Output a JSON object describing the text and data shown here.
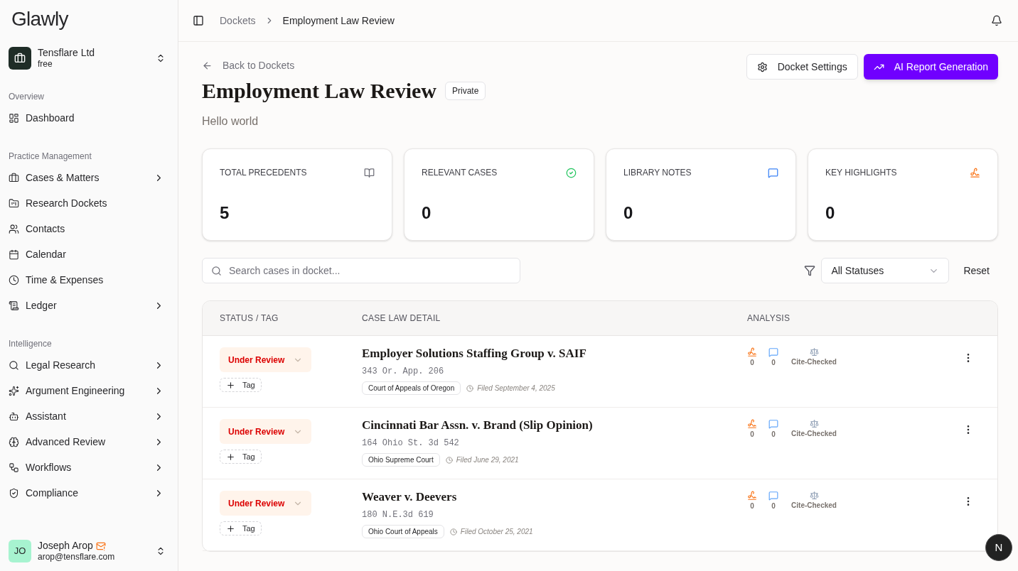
{
  "sidebar": {
    "logo": "Glawly",
    "org": {
      "name": "Tensflare Ltd",
      "plan": "free"
    },
    "sections": [
      {
        "title": "Overview",
        "items": [
          {
            "label": "Dashboard",
            "has_children": false
          }
        ]
      },
      {
        "title": "Practice Management",
        "items": [
          {
            "label": "Cases & Matters",
            "has_children": true
          },
          {
            "label": "Research Dockets",
            "has_children": false
          },
          {
            "label": "Contacts",
            "has_children": false
          },
          {
            "label": "Calendar",
            "has_children": false
          },
          {
            "label": "Time & Expenses",
            "has_children": false
          },
          {
            "label": "Ledger",
            "has_children": true
          }
        ]
      },
      {
        "title": "Intelligence",
        "items": [
          {
            "label": "Legal Research",
            "has_children": true
          },
          {
            "label": "Argument Engineering",
            "has_children": true
          },
          {
            "label": "Assistant",
            "has_children": true
          },
          {
            "label": "Advanced Review",
            "has_children": true
          },
          {
            "label": "Workflows",
            "has_children": true
          },
          {
            "label": "Compliance",
            "has_children": true
          }
        ]
      }
    ],
    "user": {
      "initials": "JO",
      "name": "Joseph Arop",
      "email": "arop@tensflare.com"
    }
  },
  "breadcrumb": [
    "Dockets",
    "Employment Law Review"
  ],
  "back_link": "Back to Dockets",
  "actions": [
    {
      "label": "Docket Settings",
      "kind": "secondary"
    },
    {
      "label": "AI Report Generation",
      "kind": "primary"
    }
  ],
  "title": "Employment Law Review",
  "visibility": "Private",
  "description": "Hello world",
  "stats": [
    {
      "label": "TOTAL PRECEDENTS",
      "value": "5"
    },
    {
      "label": "RELEVANT CASES",
      "value": "0"
    },
    {
      "label": "LIBRARY NOTES",
      "value": "0"
    },
    {
      "label": "KEY HIGHLIGHTS",
      "value": "0"
    }
  ],
  "search": {
    "placeholder": "Search cases in docket..."
  },
  "status_filter": "All Statuses",
  "reset": "Reset",
  "table": {
    "columns": [
      "STATUS / TAG",
      "CASE LAW DETAIL",
      "ANALYSIS"
    ],
    "rows": [
      {
        "status": "Under Review",
        "tag_button": "Tag",
        "title": "Employer Solutions Staffing Group v. SAIF",
        "citation": "343 Or. App. 206",
        "court": "Court of Appeals of Oregon",
        "filed": "Filed September 4, 2025",
        "highlights": "0",
        "notes": "0",
        "check": "Cite-Checked"
      },
      {
        "status": "Under Review",
        "tag_button": "Tag",
        "title": "Cincinnati Bar Assn. v. Brand (Slip Opinion)",
        "citation": "164 Ohio St. 3d 542",
        "court": "Ohio Supreme Court",
        "filed": "Filed June 29, 2021",
        "highlights": "0",
        "notes": "0",
        "check": "Cite-Checked"
      },
      {
        "status": "Under Review",
        "tag_button": "Tag",
        "title": "Weaver v. Deevers",
        "citation": "180 N.E.3d 619",
        "court": "Ohio Court of Appeals",
        "filed": "Filed October 25, 2021",
        "highlights": "0",
        "notes": "0",
        "check": "Cite-Checked"
      }
    ]
  },
  "floating_badge": "N"
}
